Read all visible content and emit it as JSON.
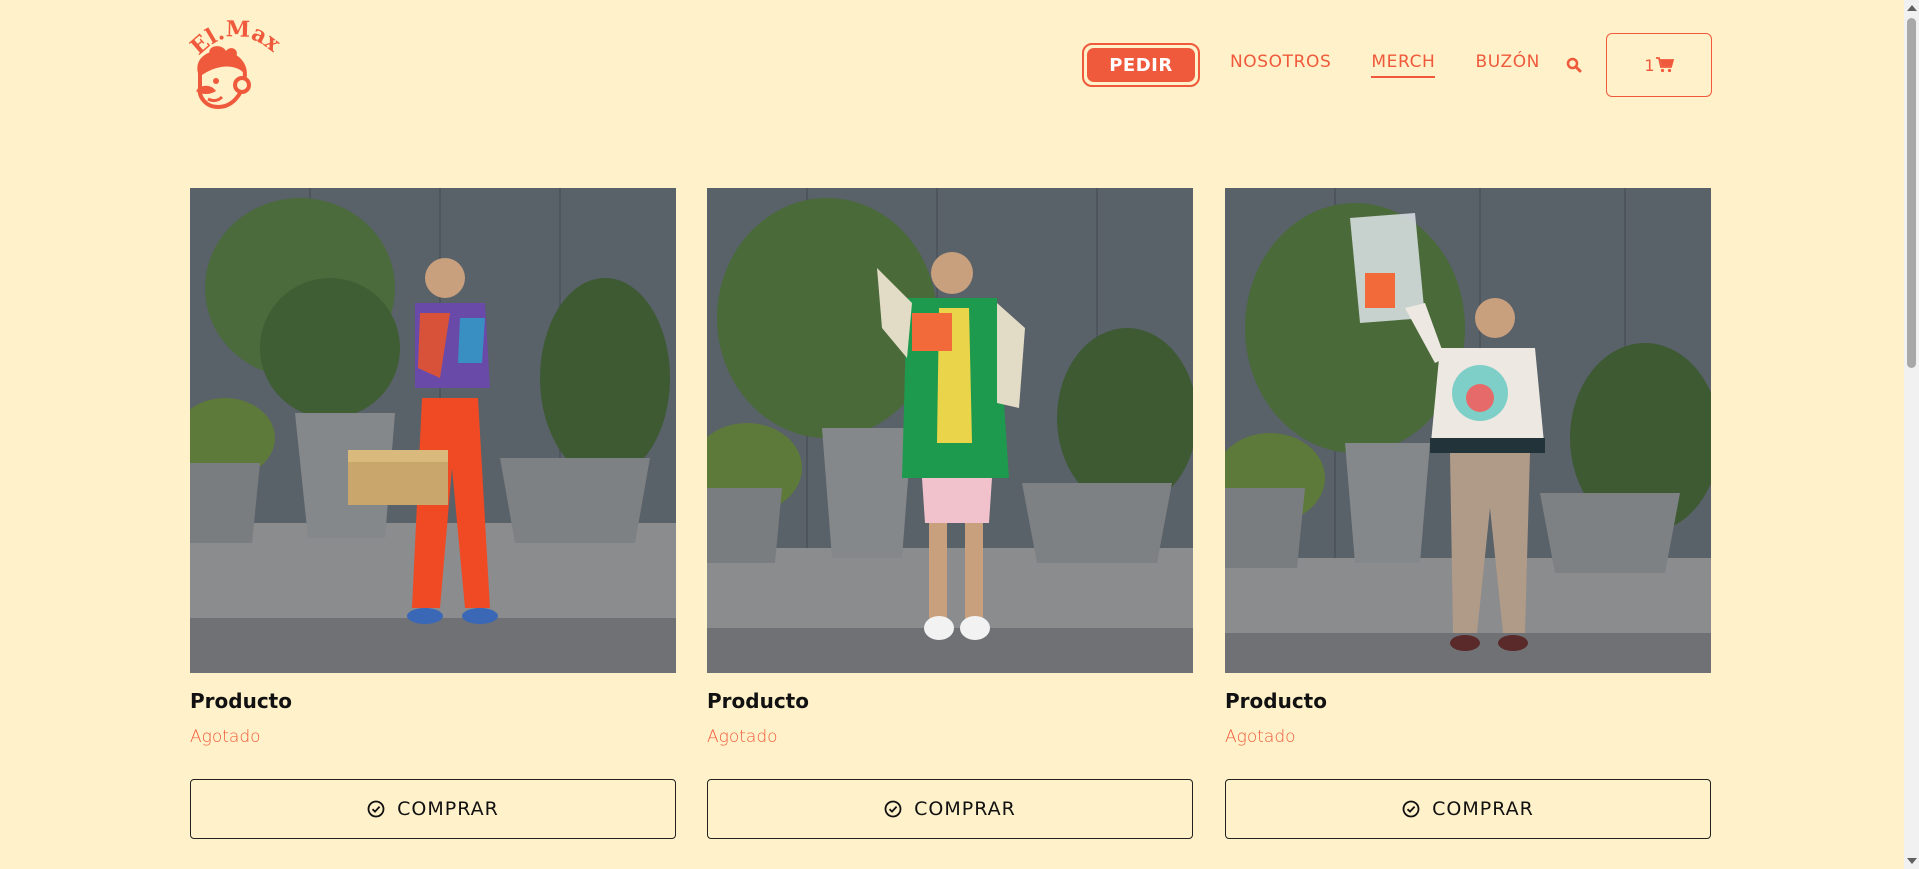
{
  "header": {
    "logo_text": "El.Max",
    "pedir_label": "PEDIR",
    "nav": [
      {
        "label": "NOSOTROS"
      },
      {
        "label": "MERCH",
        "active": true
      },
      {
        "label": "BUZÓN"
      }
    ],
    "cart_count": "1"
  },
  "products": [
    {
      "title": "Producto",
      "status": "Agotado",
      "button_label": "COMPRAR"
    },
    {
      "title": "Producto",
      "status": "Agotado",
      "button_label": "COMPRAR"
    },
    {
      "title": "Producto",
      "status": "Agotado",
      "button_label": "COMPRAR"
    }
  ],
  "colors": {
    "background": "#FFF1C9",
    "accent": "#F05A3C",
    "text": "#111111"
  },
  "icons": {
    "search": "search-icon",
    "cart": "cart-icon",
    "buy": "check-circle-icon"
  }
}
